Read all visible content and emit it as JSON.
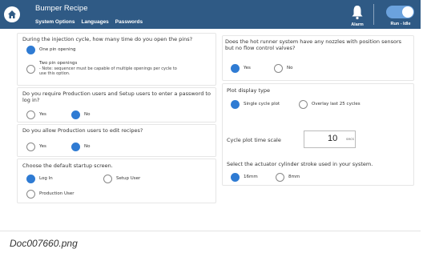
{
  "header": {
    "title": "Bumper Recipe",
    "menu": [
      "System Options",
      "Languages",
      "Passwords"
    ],
    "alarm_label": "Alarm",
    "run_label": "Run - Idle",
    "home_icon": "home-icon",
    "alarm_icon": "bell-icon",
    "colors": {
      "bar": "#2f5a85",
      "accent": "#2f7bd3",
      "toggle": "#6ba2dd"
    }
  },
  "left": {
    "q1": {
      "question": "During the injection cycle, how many time do you open the pins?",
      "options": [
        {
          "label": "One pin opening",
          "selected": true
        },
        {
          "label": "Two pin openings",
          "note": "- Note: sequencer must be capable of multiple openings per cycle to use this option.",
          "selected": false
        }
      ]
    },
    "q2": {
      "question": "Do you require Production users and Setup users to enter a password to log in?",
      "options": [
        {
          "label": "Yes",
          "selected": false
        },
        {
          "label": "No",
          "selected": true
        }
      ]
    },
    "q3": {
      "question": "Do you allow Production users to edit recipes?",
      "options": [
        {
          "label": "Yes",
          "selected": false
        },
        {
          "label": "No",
          "selected": true
        }
      ]
    },
    "q4": {
      "question": "Choose the default startup screen.",
      "options": [
        {
          "label": "Log In",
          "selected": true
        },
        {
          "label": "Setup User",
          "selected": false
        },
        {
          "label": "Production User",
          "selected": false
        }
      ]
    }
  },
  "right": {
    "q5": {
      "question": "Does the hot runner system have any nozzles with position sensors but no flow control valves?",
      "options": [
        {
          "label": "Yes",
          "selected": true
        },
        {
          "label": "No",
          "selected": false
        }
      ]
    },
    "plot": {
      "title": "Plot display type",
      "options": [
        {
          "label": "Single cycle plot",
          "selected": true
        },
        {
          "label": "Overlay last 25 cycles",
          "selected": false
        }
      ],
      "time_scale_label": "Cycle plot time scale",
      "time_scale_value": "10",
      "time_scale_unit": "secs",
      "stroke_question": "Select the actuator cylinder stroke used in your system.",
      "stroke_options": [
        {
          "label": "16mm",
          "selected": true
        },
        {
          "label": "8mm",
          "selected": false
        }
      ]
    }
  },
  "caption": "Doc007660.png"
}
